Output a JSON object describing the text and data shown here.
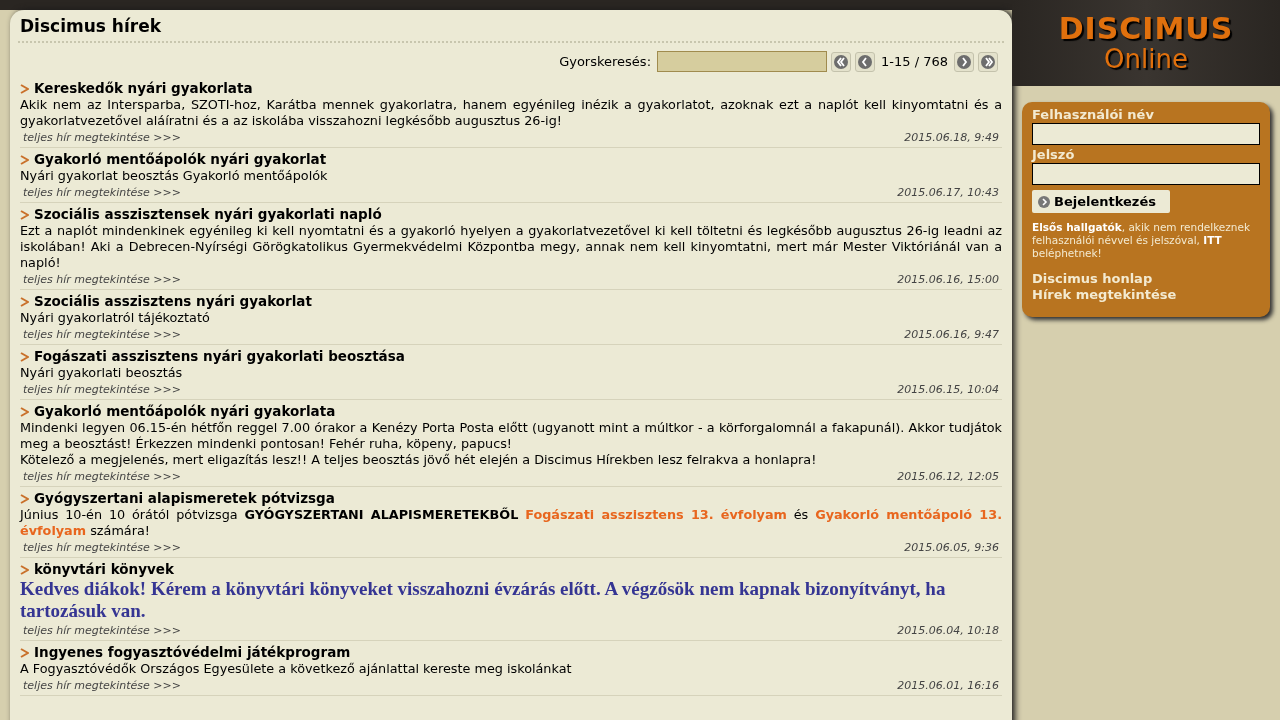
{
  "page_title": "Discimus hírek",
  "search": {
    "label": "Gyorskeresés:",
    "range": "1-15 / 768"
  },
  "news": [
    {
      "title": "Kereskedők nyári gyakorlata",
      "kind": "plain",
      "lines": [
        [
          {
            "text": "Akik nem az Intersparba, SZOTI-hoz, Karátba mennek gyakorlatra, hanem egyénileg inézik a gyakorlatot, azoknak ezt a naplót kell kinyomtatni és a gyakorlatvezetővel aláíratni és a az iskolába visszahozni legkésőbb augusztus 26-ig!",
            "kind": "text"
          }
        ]
      ],
      "link": "teljes hír megtekintése >>>",
      "date": "2015.06.18, 9:49"
    },
    {
      "title": "Gyakorló mentőápolók nyári gyakorlat",
      "kind": "plain",
      "lines": [
        [
          {
            "text": "Nyári gyakorlat beosztás Gyakorló mentőápolók",
            "kind": "text"
          }
        ]
      ],
      "link": "teljes hír megtekintése >>>",
      "date": "2015.06.17, 10:43"
    },
    {
      "title": "Szociális asszisztensek nyári gyakorlati napló",
      "kind": "plain",
      "lines": [
        [
          {
            "text": "Ezt a naplót mindenkinek egyénileg ki kell nyomtatni és a gyakorló hyelyen a gyakorlatvezetővel ki kell töltetni és legkésőbb augusztus 26-ig leadni az iskolában! Aki a Debrecen-Nyírségi Görögkatolikus Gyermekvédelmi Központba megy, annak nem kell kinyomtatni, mert már Mester Viktóriánál van a napló!",
            "kind": "text"
          }
        ]
      ],
      "link": "teljes hír megtekintése >>>",
      "date": "2015.06.16, 15:00"
    },
    {
      "title": "Szociális asszisztens nyári gyakorlat",
      "kind": "plain",
      "lines": [
        [
          {
            "text": "Nyári gyakorlatról tájékoztató",
            "kind": "text"
          }
        ]
      ],
      "link": "teljes hír megtekintése >>>",
      "date": "2015.06.16, 9:47"
    },
    {
      "title": "Fogászati asszisztens nyári gyakorlati beosztása",
      "kind": "plain",
      "lines": [
        [
          {
            "text": "Nyári gyakorlati beosztás",
            "kind": "text"
          }
        ]
      ],
      "link": "teljes hír megtekintése >>>",
      "date": "2015.06.15, 10:04"
    },
    {
      "title": "Gyakorló mentőápolók nyári gyakorlata",
      "kind": "plain",
      "lines": [
        [
          {
            "text": "Mindenki legyen 06.15-én hétfőn reggel 7.00 órakor a Kenézy Porta Posta előtt (ugyanott mint a múltkor - a körforgalomnál a fakapunál). Akkor tudjátok meg a beosztást! Érkezzen mindenki pontosan! Fehér ruha, köpeny, papucs!",
            "kind": "text"
          }
        ],
        [
          {
            "text": "Kötelező a megjelenés, mert eligazítás lesz!! A teljes beosztás jövő hét elején a Discimus Hírekben lesz felrakva a honlapra!",
            "kind": "text"
          }
        ]
      ],
      "link": "teljes hír megtekintése >>>",
      "date": "2015.06.12, 12:05"
    },
    {
      "title": "Gyógyszertani alapismeretek pótvizsga",
      "kind": "plain",
      "lines": [
        [
          {
            "text": "Június 10-én 10 órától pótvizsga **GYÓGYSZERTANI ALAPISMERETEKBŐL**",
            "kind": "text"
          },
          {
            "text": "Fogászati asszisztens 13. évfolyam",
            "kind": "highlight"
          },
          {
            "text": "és",
            "kind": "text"
          },
          {
            "text": "Gyakorló mentőápoló 13. évfolyam",
            "kind": "highlight"
          },
          {
            "text": "számára!",
            "kind": "text"
          }
        ]
      ],
      "link": "teljes hír megtekintése >>>",
      "date": "2015.06.05, 9:36"
    },
    {
      "title": "könyvtári könyvek",
      "kind": "large",
      "lines": [
        [
          {
            "text": "Kedves diákok! Kérem a könyvtári könyveket visszahozni évzárás előtt. A végzősök nem kapnak bizonyítványt, ha tartozásuk van.",
            "kind": "text"
          }
        ]
      ],
      "link": "teljes hír megtekintése >>>",
      "date": "2015.06.04, 10:18"
    },
    {
      "title": "Ingyenes fogyasztóvédelmi játékprogram",
      "kind": "plain",
      "lines": [
        [
          {
            "text": "A Fogyasztóvédők Országos Egyesülete a következő ajánlattal kereste meg iskolánkat",
            "kind": "text"
          }
        ]
      ],
      "link": "teljes hír megtekintése >>>",
      "date": "2015.06.01, 16:16"
    }
  ],
  "logo": {
    "line_1": "DISCIMUS",
    "line_2": "Online"
  },
  "login": {
    "username_label": "Felhasználói név",
    "password_label": "Jelszó",
    "button": "Bejelentkezés",
    "note": "**Elsős hallgatók**, akik nem rendelkeznek felhasználói névvel és jelszóval, **ITT** beléphetnek!",
    "links": [
      "Discimus honlap",
      "Hírek megtekintése"
    ]
  }
}
